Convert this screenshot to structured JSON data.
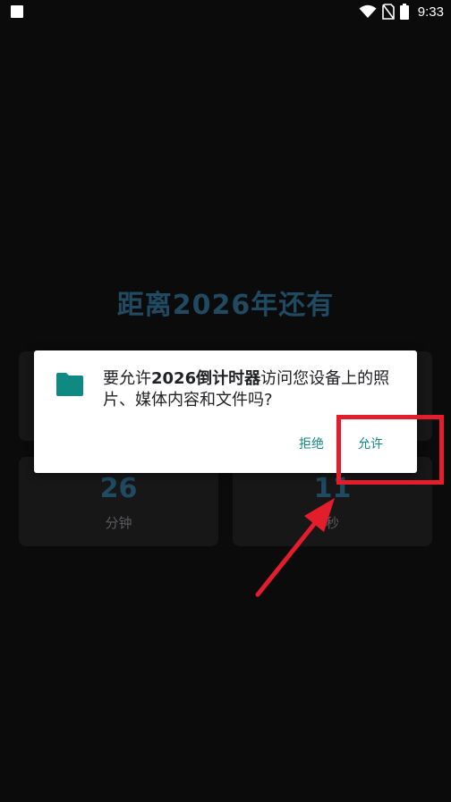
{
  "status_bar": {
    "time": "9:33",
    "icons": [
      "notification-square-icon",
      "wifi-icon",
      "no-sim-icon",
      "battery-icon"
    ]
  },
  "countdown": {
    "title": "距离2026年还有",
    "cards": [
      {
        "value": "",
        "label": ""
      },
      {
        "value": "",
        "label": ""
      },
      {
        "value": "26",
        "label": "分钟"
      },
      {
        "value": "11",
        "label": "秒"
      }
    ]
  },
  "dialog": {
    "message_prefix": "要允许",
    "app_name": "2026倒计时器",
    "message_suffix": "访问您设备上的照片、媒体内容和文件吗?",
    "icon": "folder-icon",
    "deny_label": "拒绝",
    "allow_label": "允许"
  },
  "colors": {
    "background": "#0b0b0c",
    "accent": "#0f8a82",
    "countdown_text": "#1f4a62",
    "annotation": "#e41d2d"
  }
}
